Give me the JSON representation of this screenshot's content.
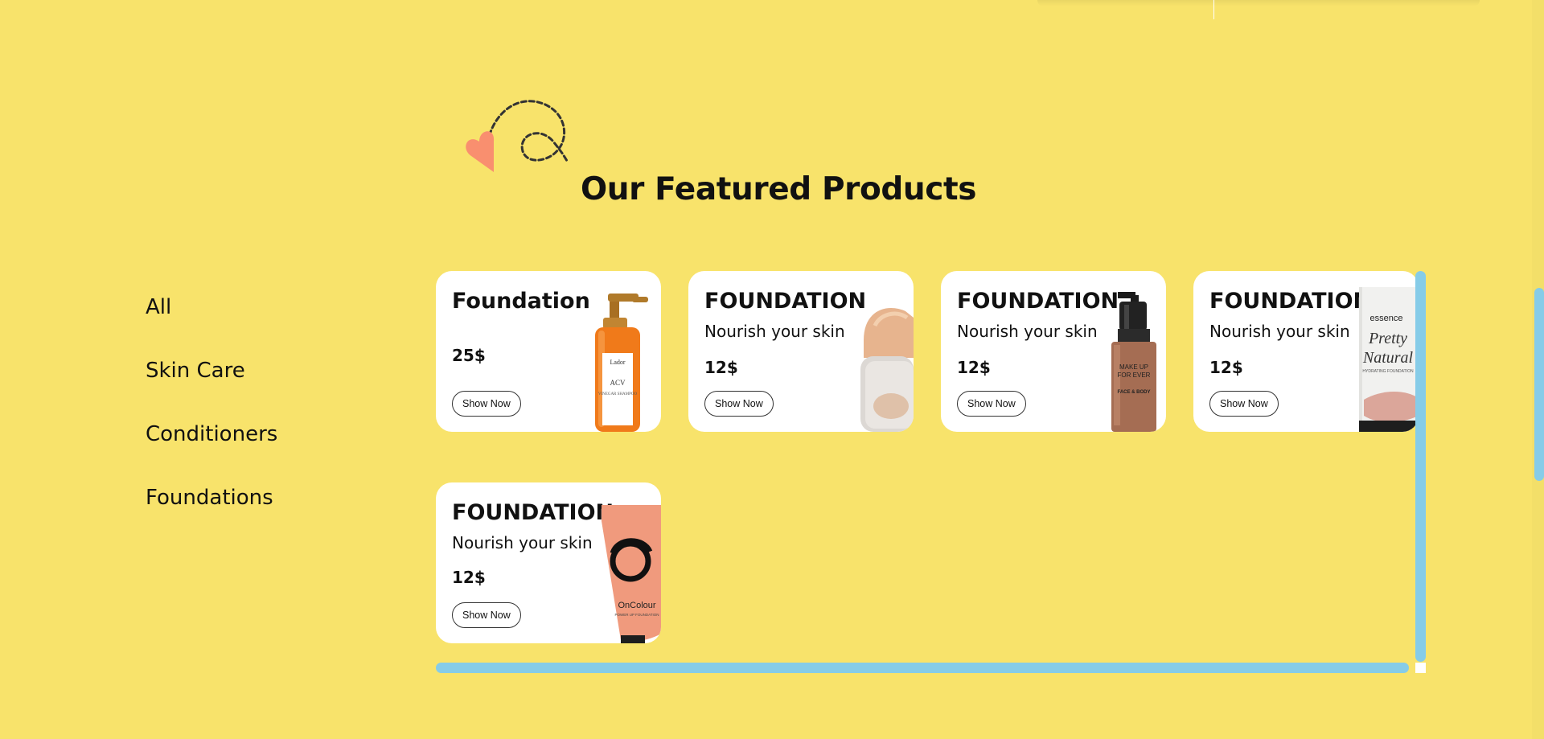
{
  "section": {
    "title": "Our Featured Products"
  },
  "categories": [
    "All",
    "Skin Care",
    "Conditioners",
    "Foundations"
  ],
  "products": [
    {
      "title": "Foundation",
      "subtitle": "",
      "price": "25$",
      "button": "Show Now",
      "image": "orange-shampoo-bottle"
    },
    {
      "title": "FOUNDATION",
      "subtitle": "Nourish your skin",
      "price": "12$",
      "button": "Show Now",
      "image": "cream-jar"
    },
    {
      "title": "FOUNDATION",
      "subtitle": "Nourish your skin",
      "price": "12$",
      "button": "Show Now",
      "image": "pump-bottle-face-body"
    },
    {
      "title": "FOUNDATION",
      "subtitle": "Nourish your skin",
      "price": "12$",
      "button": "Show Now",
      "image": "essence-pretty-natural-tube"
    },
    {
      "title": "FOUNDATION",
      "subtitle": "Nourish your skin",
      "price": "12$",
      "button": "Show Now",
      "image": "oncolour-tube"
    }
  ],
  "product_images": {
    "bottle_label_top": "Lador",
    "bottle_label_main": "ACV",
    "bottle_label_sub": "VINEGAR SHAMPOO",
    "pump_label_1": "MAKE UP",
    "pump_label_2": "FOR EVER",
    "pump_label_3": "FACE & BODY",
    "tube_brand": "essence",
    "tube_script_1": "Pretty",
    "tube_script_2": "Natural",
    "tube_sub": "HYDRATING FOUNDATION",
    "oncolour_brand": "OnColour",
    "oncolour_sub": "POWER UP FOUNDATION"
  },
  "colors": {
    "background": "#f8e36b",
    "card": "#ffffff",
    "scrollbar": "#86cce8",
    "heart": "#f98f6f"
  }
}
